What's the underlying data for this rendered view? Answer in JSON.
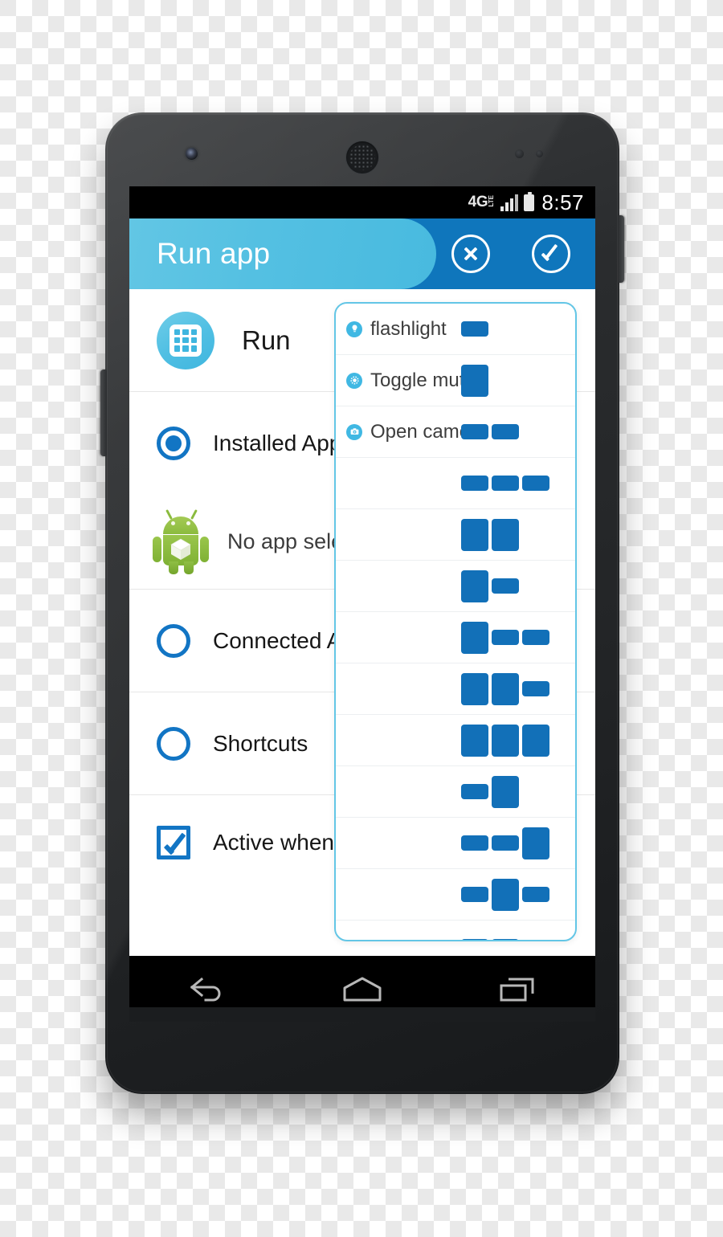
{
  "status_bar": {
    "network_type": "4G",
    "network_sub": "LTE",
    "signal_bars_total": 4,
    "signal_bars_filled": 3,
    "battery": "full",
    "time": "8:57"
  },
  "title_bar": {
    "title": "Run app",
    "cancel_icon": "circle-x-icon",
    "confirm_icon": "circle-check-icon",
    "pill_color": "#54C0E2",
    "bar_color": "#0F76BC"
  },
  "header": {
    "icon": "apps-grid-icon",
    "label": "Run"
  },
  "options": [
    {
      "label": "Installed Apps",
      "type": "radio",
      "selected": true
    },
    {
      "label": "Connected Apps",
      "type": "radio",
      "selected": false
    },
    {
      "label": "Shortcuts",
      "type": "radio",
      "selected": false
    }
  ],
  "selected_app": {
    "icon": "android-robot-icon",
    "label": "No app selected"
  },
  "checkbox_option": {
    "label": "Active when screen off",
    "checked": true
  },
  "overlay_panel": {
    "border_color": "#63C6E6",
    "block_color": "#1270B8",
    "rows": [
      {
        "icon": "flashlight-icon",
        "label": "flashlight",
        "pattern": [
          "s"
        ]
      },
      {
        "icon": "mute-icon",
        "label": "Toggle mute",
        "pattern": [
          "t"
        ]
      },
      {
        "icon": "camera-icon",
        "label": "Open camera",
        "pattern": [
          "s",
          "s"
        ]
      },
      {
        "icon": "",
        "label": "",
        "pattern": [
          "s",
          "s",
          "s"
        ]
      },
      {
        "icon": "",
        "label": "",
        "pattern": [
          "t",
          "t"
        ]
      },
      {
        "icon": "",
        "label": "",
        "pattern": [
          "t",
          "s"
        ]
      },
      {
        "icon": "",
        "label": "",
        "pattern": [
          "t",
          "s",
          "s"
        ]
      },
      {
        "icon": "",
        "label": "",
        "pattern": [
          "t",
          "t",
          "s"
        ]
      },
      {
        "icon": "",
        "label": "",
        "pattern": [
          "t",
          "t",
          "t"
        ]
      },
      {
        "icon": "",
        "label": "",
        "pattern": [
          "s",
          "t"
        ]
      },
      {
        "icon": "",
        "label": "",
        "pattern": [
          "s",
          "s",
          "t"
        ]
      },
      {
        "icon": "",
        "label": "",
        "pattern": [
          "s",
          "t",
          "s"
        ]
      },
      {
        "icon": "",
        "label": "",
        "pattern": [
          "s",
          "s"
        ]
      }
    ]
  },
  "nav_bar": {
    "back": "back-arrow-icon",
    "home": "home-icon",
    "recents": "recent-apps-icon"
  }
}
